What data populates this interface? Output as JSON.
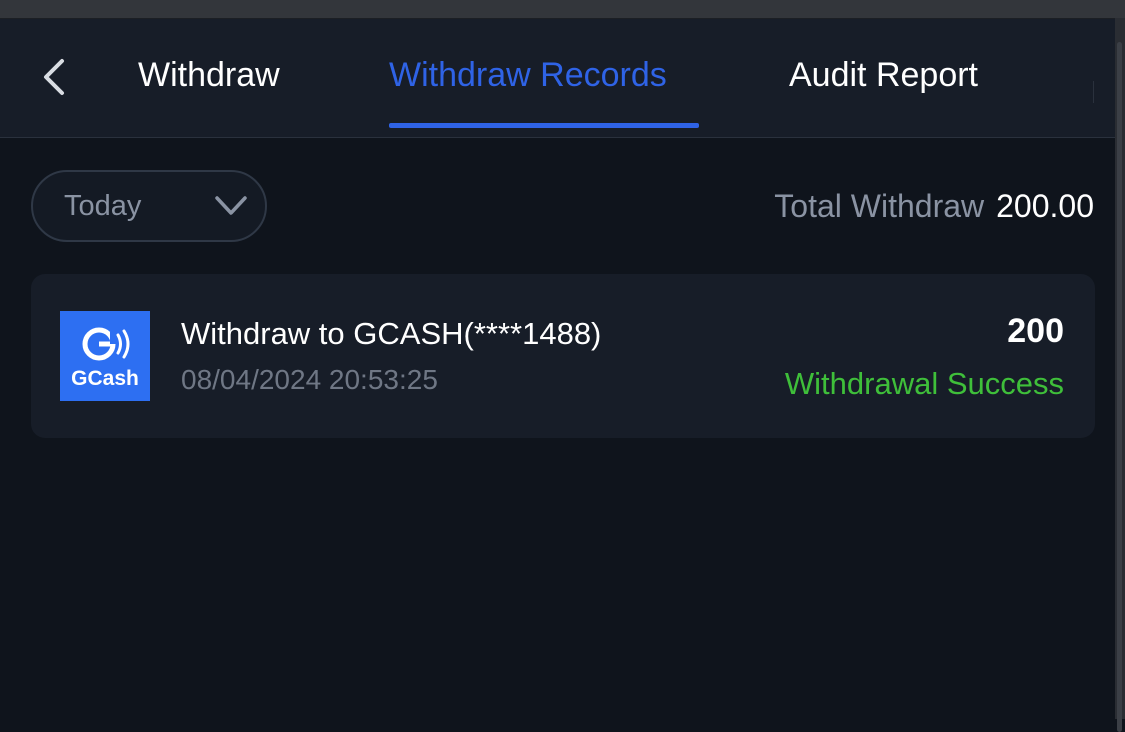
{
  "header": {
    "back_icon": "chevron-left-icon",
    "tabs": [
      {
        "label": "Withdraw",
        "active": false
      },
      {
        "label": "Withdraw Records",
        "active": true
      },
      {
        "label": "Audit Report",
        "active": false
      }
    ]
  },
  "filter": {
    "selected": "Today",
    "icon": "chevron-down-icon"
  },
  "summary": {
    "label": "Total Withdraw",
    "value": "200.00"
  },
  "records": [
    {
      "logo_text": "GCash",
      "title": "Withdraw to GCASH(****1488)",
      "timestamp": "08/04/2024 20:53:25",
      "amount": "200",
      "status": "Withdrawal Success"
    }
  ],
  "colors": {
    "background": "#0f141c",
    "panel": "#171d28",
    "accent": "#2f63e6",
    "success": "#3fbf3a",
    "muted": "#8a93a3",
    "gcash_blue": "#2d6ff2"
  }
}
